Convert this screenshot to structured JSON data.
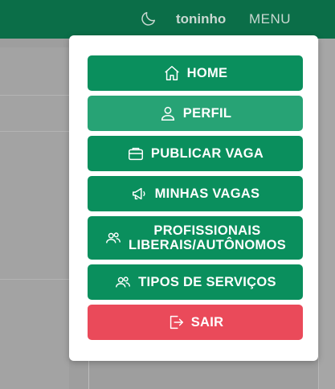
{
  "header": {
    "theme_toggle_icon": "moon-icon",
    "username": "toninho",
    "menu_label": "MENU"
  },
  "menu": {
    "items": [
      {
        "label": "HOME",
        "icon": "home-icon",
        "color": "#0a8f5d"
      },
      {
        "label": "PERFIL",
        "icon": "user-icon",
        "color": "#27a375",
        "active": true
      },
      {
        "label": "PUBLICAR VAGA",
        "icon": "briefcase-icon",
        "color": "#0a8f5d"
      },
      {
        "label": "MINHAS VAGAS",
        "icon": "megaphone-icon",
        "color": "#0a8f5d"
      },
      {
        "label_line1": "PROFISSIONAIS",
        "label_line2": "LIBERAIS/AUTÔNOMOS",
        "icon": "users-icon",
        "color": "#0a8f5d"
      },
      {
        "label": "TIPOS DE SERVIÇOS",
        "icon": "users-icon",
        "color": "#0a8f5d"
      },
      {
        "label": "SAIR",
        "icon": "logout-icon",
        "color": "#ea4a5a"
      }
    ]
  },
  "colors": {
    "brand_green": "#0b6e48",
    "button_green": "#0a8f5d",
    "button_active": "#27a375",
    "danger": "#ea4a5a",
    "overlay": "#9e9e9e"
  }
}
